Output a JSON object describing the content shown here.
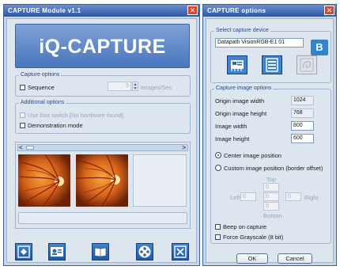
{
  "module_window": {
    "title": "CAPTURE Module v1.1",
    "close_glyph": "✕",
    "logo_text": "iQ-CAPTURE",
    "capture_options": {
      "legend": "Capture options",
      "sequence_label": "Sequence",
      "sequence_checked": false,
      "sequence_value": "5",
      "rate_unit": "Images/Sec"
    },
    "additional_options": {
      "legend": "Additional options",
      "foot_switch_label": "Use foot switch [No hardware found]",
      "foot_switch_checked": false,
      "demo_mode_label": "Demonstration mode",
      "demo_mode_checked": false
    },
    "thumbnail_strip": {
      "scroll_left_glyph": "<",
      "scroll_right_glyph": ">",
      "thumbnails": [
        "retina-image-1",
        "retina-image-2",
        "empty-slot"
      ]
    },
    "status_text": "",
    "toolbar_icons": [
      "capture-icon",
      "patient-icon",
      "book-icon",
      "film-reel-icon",
      "close-icon"
    ],
    "colors": {
      "title_bar": "#2f56a4",
      "logo_bg": "#4f7cc0",
      "icon_button": "#2a6bb8"
    }
  },
  "options_window": {
    "title": "CAPTURE options",
    "close_glyph": "✕",
    "badge": "B",
    "device_group": {
      "legend": "Select capture device",
      "selected_device": "Datapath VisionRGB-E1 01",
      "device_icons": [
        "capture-card-icon",
        "server-icon",
        "firewire-icon"
      ]
    },
    "image_group": {
      "legend": "Capture image options",
      "rows": [
        {
          "label": "Origin image width",
          "value": "1024",
          "editable": false
        },
        {
          "label": "Origin image height",
          "value": "768",
          "editable": false
        },
        {
          "label": "Image width",
          "value": "800",
          "editable": true
        },
        {
          "label": "Image height",
          "value": "600",
          "editable": true
        }
      ],
      "center_label": "Center image position",
      "center_selected": true,
      "custom_label": "Custom image position (border offset)",
      "custom_selected": false,
      "offset_top_label": "Top",
      "offset_left_label": "Left",
      "offset_right_label": "Right",
      "offset_bottom_label": "Bottom",
      "offset_top_value": "0",
      "offset_left_value": "0",
      "offset_right_value": "0",
      "offset_bottom_value": "0",
      "offset_center_value": "0",
      "beep_label": "Beep on capture",
      "beep_checked": false,
      "grayscale_label": "Force Grayscale (8 bit)",
      "grayscale_checked": false
    },
    "ok_label": "OK",
    "cancel_label": "Cancel",
    "colors": {
      "badge": "#2f83cf",
      "close": "#d8482d"
    }
  }
}
